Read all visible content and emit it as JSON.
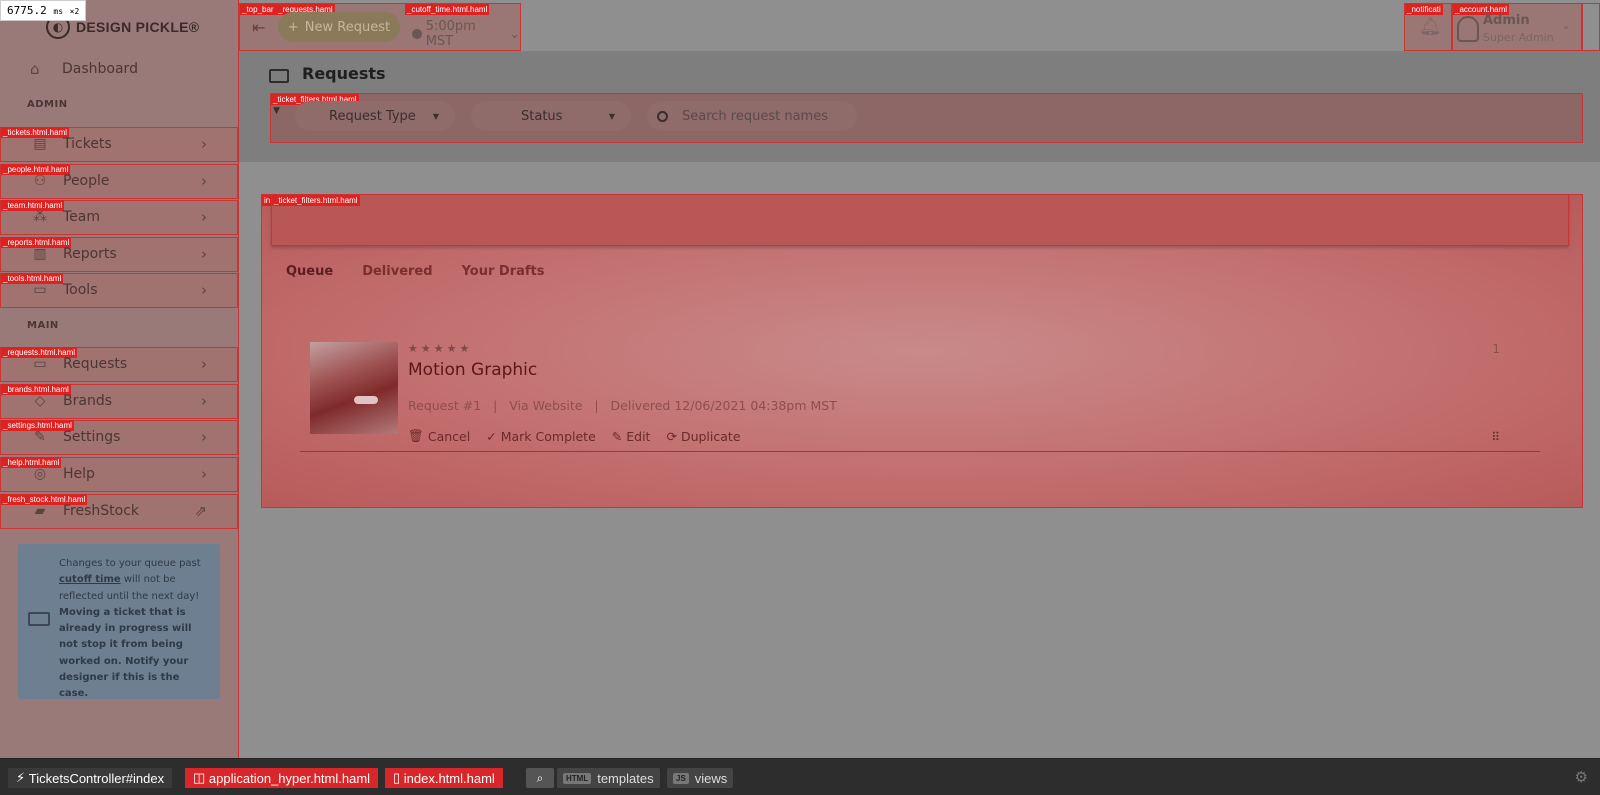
{
  "timer": {
    "value": "6775.2",
    "unit": "ms",
    "mult": "×2"
  },
  "brand": {
    "name": "DESIGN PICKLE®"
  },
  "sidebar": {
    "dashboard": "Dashboard",
    "admin_title": "ADMIN",
    "admin_items": [
      {
        "label": "Tickets",
        "tag": "_tickets.html.haml"
      },
      {
        "label": "People",
        "tag": "_people.html.haml"
      },
      {
        "label": "Team",
        "tag": "_team.html.haml"
      },
      {
        "label": "Reports",
        "tag": "_reports.html.haml"
      },
      {
        "label": "Tools",
        "tag": "_tools.html.haml"
      }
    ],
    "main_title": "MAIN",
    "main_items": [
      {
        "label": "Requests",
        "tag": "_requests.html.haml"
      },
      {
        "label": "Brands",
        "tag": "_brands.html.haml"
      },
      {
        "label": "Settings",
        "tag": "_settings.html.haml"
      },
      {
        "label": "Help",
        "tag": "_help.html.haml"
      },
      {
        "label": "FreshStock",
        "tag": "_fresh_stock.html.haml"
      }
    ],
    "note": {
      "line1": "Changes to your queue past",
      "link": "cutoff time",
      "line2": " will not be reflected until the next day!",
      "bold": "Moving a ticket that is already in progress will not stop it from being worked on. Notify your designer if this is the case."
    }
  },
  "topbar": {
    "tags": {
      "top_bar": "_top_bar",
      "requests": "_requests.haml",
      "cutoff": "_cutoff_time.html.haml",
      "notifications": "_notificati",
      "account": "_account.haml"
    },
    "new_request": "New Request",
    "cutoff_time": "5:00pm MST",
    "account_name": "Admin",
    "account_role": "Super Admin"
  },
  "page": {
    "title": "Requests",
    "filters_tag": "_ticket_filters.html.haml",
    "filter_type": "Request Type",
    "filter_status": "Status",
    "search_placeholder": "Search request names",
    "panel_tag": "in",
    "panel_filter_tag": "_ticket_filters.html.haml",
    "tabs": [
      "Queue",
      "Delivered",
      "Your Drafts"
    ]
  },
  "request": {
    "stars": "★★★★★",
    "title": "Motion Graphic",
    "number": "Request #1",
    "source": "Via Website",
    "delivered": "Delivered 12/06/2021 04:38pm MST",
    "sep": "|",
    "position": "1",
    "actions": {
      "cancel": "Cancel",
      "complete": "Mark Complete",
      "edit": "Edit",
      "duplicate": "Duplicate"
    }
  },
  "devbar": {
    "controller": "TicketsController#index",
    "layout": "application_hyper.html.haml",
    "view": "index.html.haml",
    "templates_badge": "HTML",
    "templates": "templates",
    "views_badge": "JS",
    "views": "views"
  }
}
